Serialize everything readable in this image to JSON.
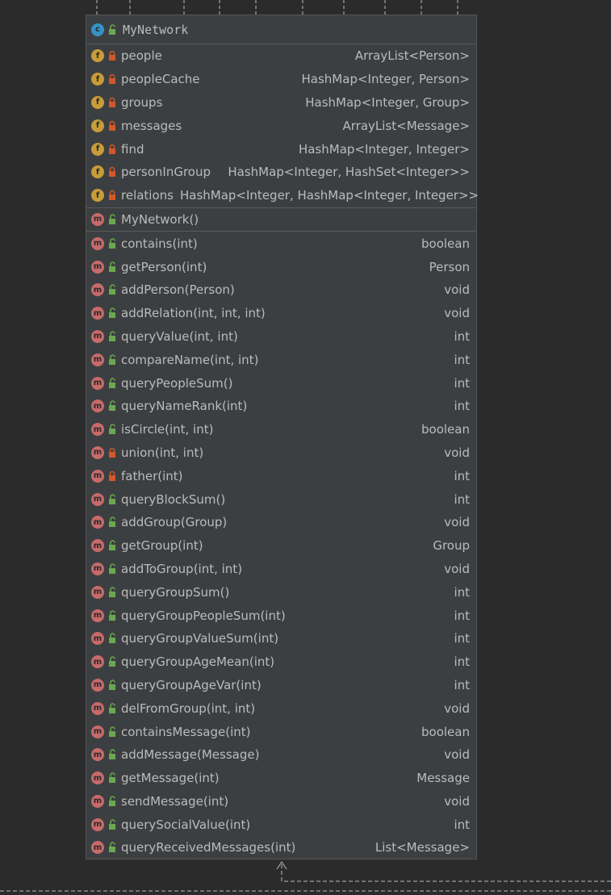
{
  "class_box": {
    "kind_icon": "class-icon",
    "name": "MyNetwork"
  },
  "fields": [
    {
      "name": "people",
      "type": "ArrayList<Person>",
      "visibility": "private"
    },
    {
      "name": "peopleCache",
      "type": "HashMap<Integer, Person>",
      "visibility": "private"
    },
    {
      "name": "groups",
      "type": "HashMap<Integer, Group>",
      "visibility": "private"
    },
    {
      "name": "messages",
      "type": "ArrayList<Message>",
      "visibility": "private"
    },
    {
      "name": "find",
      "type": "HashMap<Integer, Integer>",
      "visibility": "private"
    },
    {
      "name": "personInGroup",
      "type": "HashMap<Integer, HashSet<Integer>>",
      "visibility": "private"
    },
    {
      "name": "relations",
      "type": "HashMap<Integer, HashMap<Integer, Integer>>",
      "visibility": "private"
    }
  ],
  "constructors": [
    {
      "name": "MyNetwork()",
      "type": "",
      "visibility": "public"
    }
  ],
  "methods": [
    {
      "name": "contains(int)",
      "type": "boolean",
      "visibility": "public"
    },
    {
      "name": "getPerson(int)",
      "type": "Person",
      "visibility": "public"
    },
    {
      "name": "addPerson(Person)",
      "type": "void",
      "visibility": "public"
    },
    {
      "name": "addRelation(int, int, int)",
      "type": "void",
      "visibility": "public"
    },
    {
      "name": "queryValue(int, int)",
      "type": "int",
      "visibility": "public"
    },
    {
      "name": "compareName(int, int)",
      "type": "int",
      "visibility": "public"
    },
    {
      "name": "queryPeopleSum()",
      "type": "int",
      "visibility": "public"
    },
    {
      "name": "queryNameRank(int)",
      "type": "int",
      "visibility": "public"
    },
    {
      "name": "isCircle(int, int)",
      "type": "boolean",
      "visibility": "public"
    },
    {
      "name": "union(int, int)",
      "type": "void",
      "visibility": "private"
    },
    {
      "name": "father(int)",
      "type": "int",
      "visibility": "private"
    },
    {
      "name": "queryBlockSum()",
      "type": "int",
      "visibility": "public"
    },
    {
      "name": "addGroup(Group)",
      "type": "void",
      "visibility": "public"
    },
    {
      "name": "getGroup(int)",
      "type": "Group",
      "visibility": "public"
    },
    {
      "name": "addToGroup(int, int)",
      "type": "void",
      "visibility": "public"
    },
    {
      "name": "queryGroupSum()",
      "type": "int",
      "visibility": "public"
    },
    {
      "name": "queryGroupPeopleSum(int)",
      "type": "int",
      "visibility": "public"
    },
    {
      "name": "queryGroupValueSum(int)",
      "type": "int",
      "visibility": "public"
    },
    {
      "name": "queryGroupAgeMean(int)",
      "type": "int",
      "visibility": "public"
    },
    {
      "name": "queryGroupAgeVar(int)",
      "type": "int",
      "visibility": "public"
    },
    {
      "name": "delFromGroup(int, int)",
      "type": "void",
      "visibility": "public"
    },
    {
      "name": "containsMessage(int)",
      "type": "boolean",
      "visibility": "public"
    },
    {
      "name": "addMessage(Message)",
      "type": "void",
      "visibility": "public"
    },
    {
      "name": "getMessage(int)",
      "type": "Message",
      "visibility": "public"
    },
    {
      "name": "sendMessage(int)",
      "type": "void",
      "visibility": "public"
    },
    {
      "name": "querySocialValue(int)",
      "type": "int",
      "visibility": "public"
    },
    {
      "name": "queryReceivedMessages(int)",
      "type": "List<Message>",
      "visibility": "public"
    }
  ],
  "badges": {
    "class": "c",
    "field": "f",
    "method": "m"
  },
  "colors": {
    "background": "#2b2b2b",
    "box": "#3c3f41",
    "class_badge": "#3592c4",
    "field_badge": "#c79c3a",
    "method_badge": "#c76a6a",
    "public_icon": "#6aa84f",
    "private_icon": "#d0582a",
    "connector": "#bbbbbb"
  }
}
